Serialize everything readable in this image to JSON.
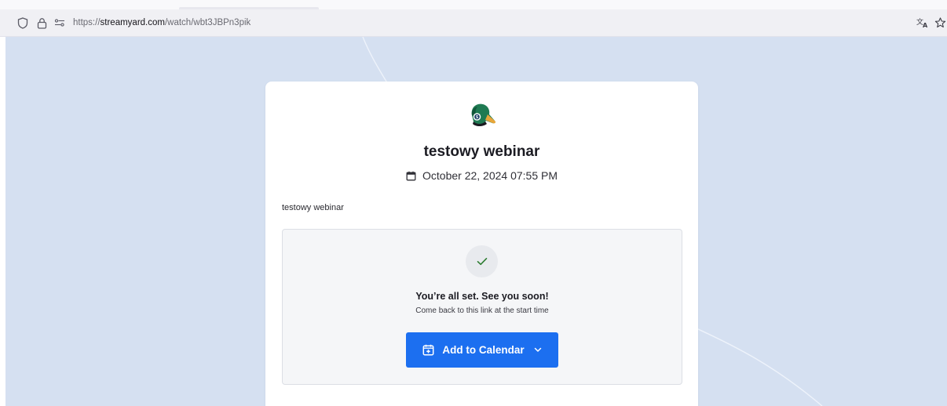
{
  "browser": {
    "url_scheme": "https://",
    "url_host": "streamyard.com",
    "url_path": "/watch/wbt3JBPn3pik"
  },
  "event": {
    "title": "testowy webinar",
    "datetime": "October 22, 2024 07:55 PM",
    "description": "testowy webinar"
  },
  "registration": {
    "status_title": "You’re all set. See you soon!",
    "status_subtitle": "Come back to this link at the start time",
    "calendar_button_label": "Add to Calendar"
  },
  "colors": {
    "page_background": "#d5e0f1",
    "accent_button": "#1c6ff0",
    "check_green": "#2e7d32"
  },
  "icons": {
    "browser": [
      "shield-icon",
      "lock-icon",
      "permissions-icon",
      "translate-icon",
      "bookmark-star-icon"
    ],
    "card": [
      "duck-logo",
      "calendar-icon",
      "checkmark-icon",
      "calendar-plus-icon",
      "chevron-down-icon"
    ]
  }
}
